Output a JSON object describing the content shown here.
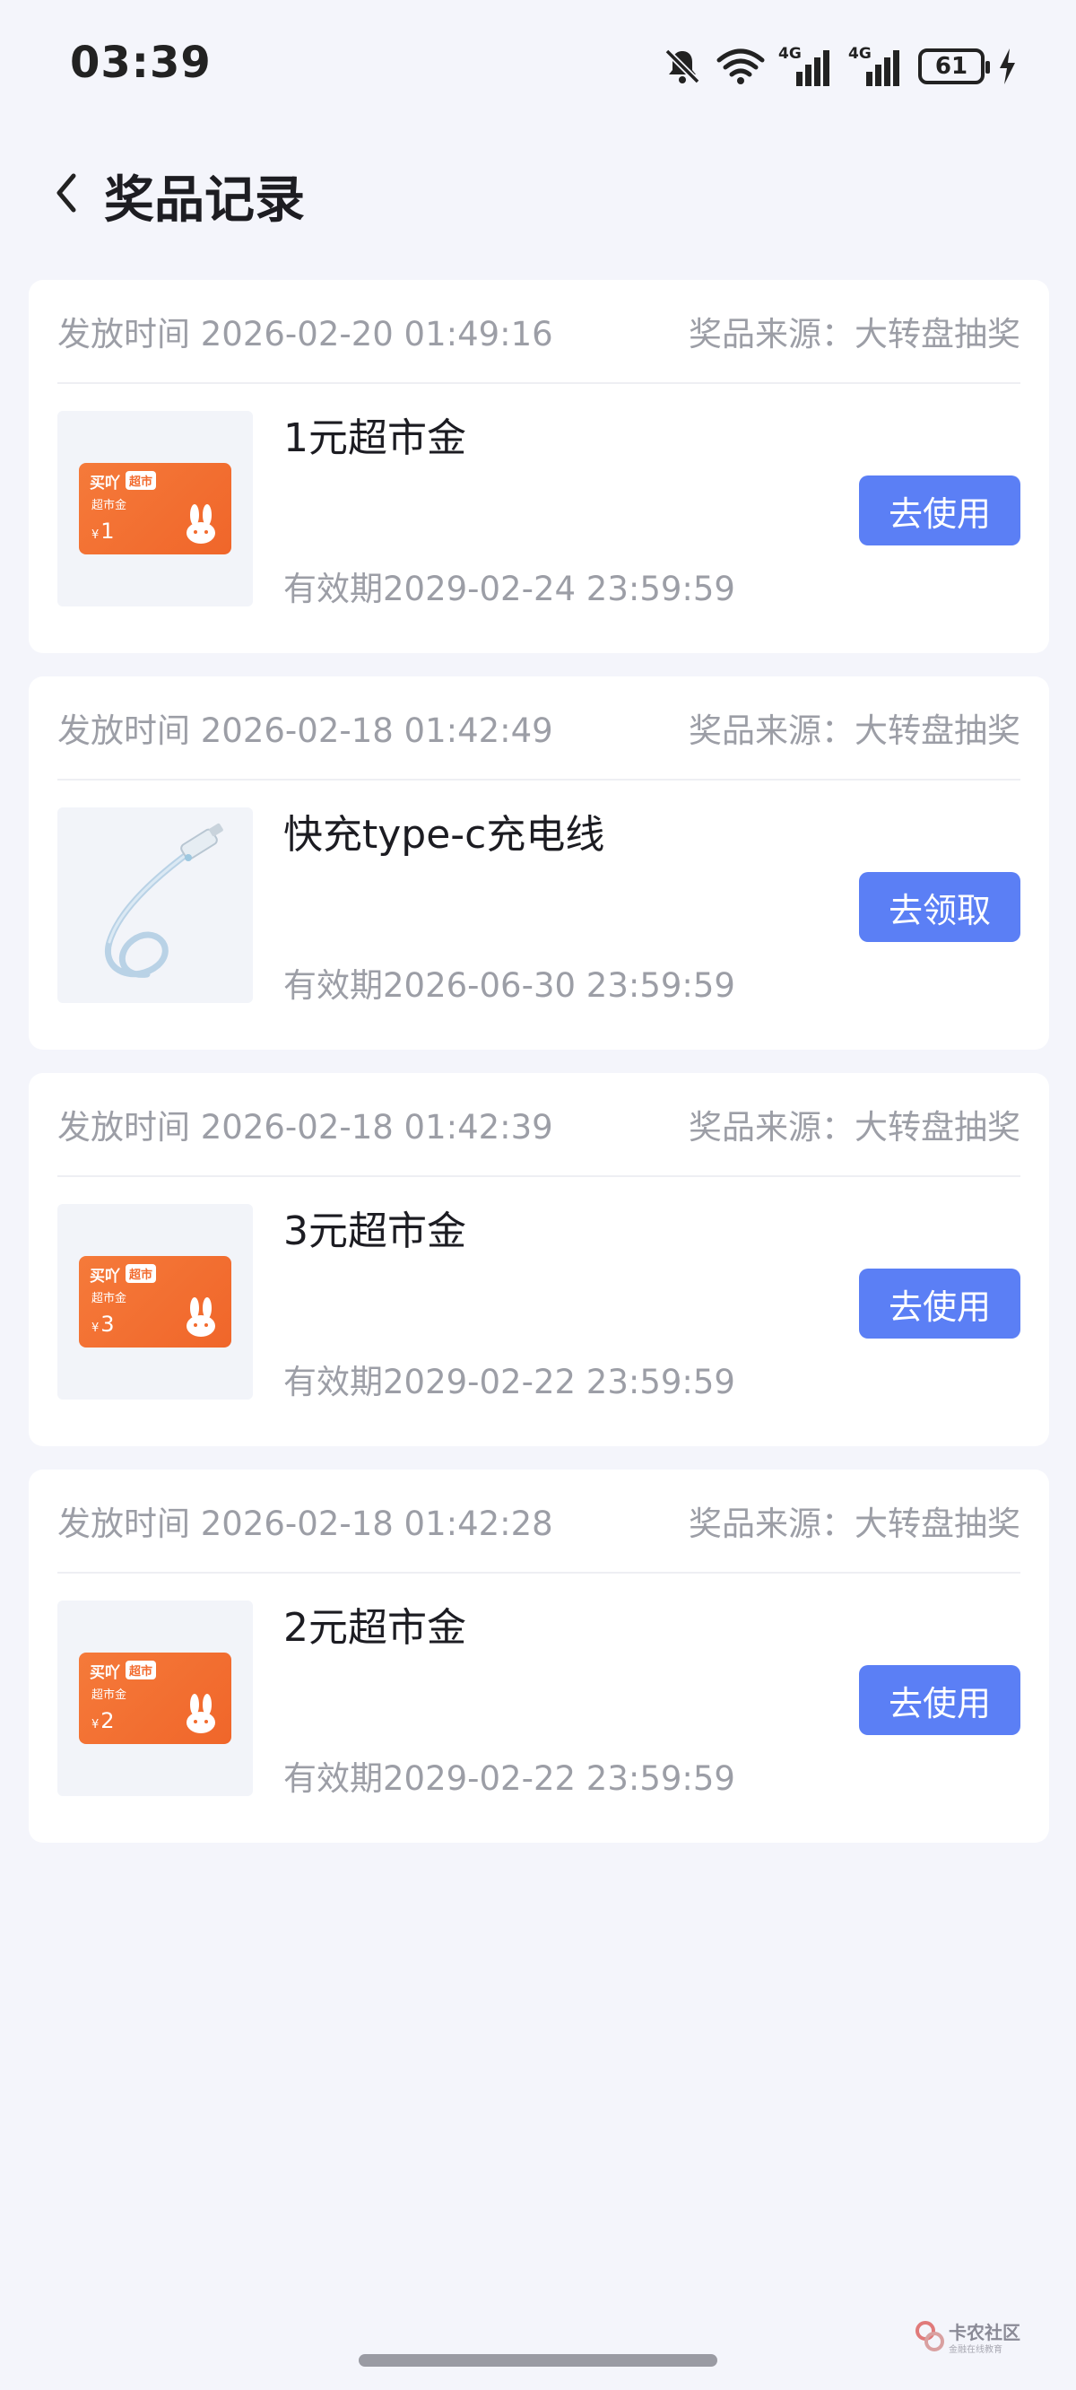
{
  "status": {
    "time": "03:39",
    "battery": "61",
    "network_1": "4G",
    "network_2": "4G"
  },
  "header": {
    "title": "奖品记录"
  },
  "records": [
    {
      "issue_time": "发放时间 2026-02-20 01:49:16",
      "source": "奖品来源：大转盘抽奖",
      "prize": "1元超市金",
      "validity": "有效期2029-02-24 23:59:59",
      "action": "去使用",
      "coupon_value": "1"
    },
    {
      "issue_time": "发放时间 2026-02-18 01:42:49",
      "source": "奖品来源：大转盘抽奖",
      "prize": "快充type-c充电线",
      "validity": "有效期2026-06-30 23:59:59",
      "action": "去领取"
    },
    {
      "issue_time": "发放时间 2026-02-18 01:42:39",
      "source": "奖品来源：大转盘抽奖",
      "prize": "3元超市金",
      "validity": "有效期2029-02-22 23:59:59",
      "action": "去使用",
      "coupon_value": "3"
    },
    {
      "issue_time": "发放时间 2026-02-18 01:42:28",
      "source": "奖品来源：大转盘抽奖",
      "prize": "2元超市金",
      "validity": "有效期2029-02-22 23:59:59",
      "action": "去使用",
      "coupon_value": "2"
    }
  ],
  "coupon_art": {
    "brand": "买吖",
    "tag": "超市",
    "sub": "超市金",
    "currency": "¥"
  },
  "watermark": {
    "title": "卡农社区",
    "sub": "金融在线教育"
  },
  "colors": {
    "background": "#f4f5fb",
    "card": "#ffffff",
    "button": "#5b7ff5",
    "coupon": "#f26a2d",
    "muted_text": "#9c9ea6"
  }
}
